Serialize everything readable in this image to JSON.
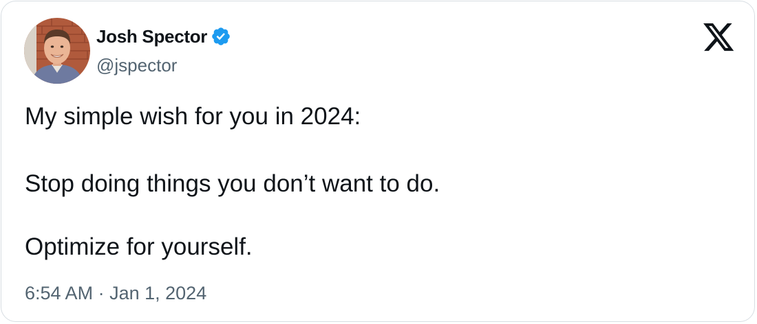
{
  "author": {
    "display_name": "Josh Spector",
    "handle": "@jspector",
    "verified": true,
    "avatar_icon": "profile-photo"
  },
  "platform": {
    "logo_icon": "x-logo-icon"
  },
  "tweet": {
    "lines": [
      "My simple wish for you in 2024:",
      "Stop doing things you don’t want to do.",
      "Optimize for yourself."
    ],
    "time": "6:54 AM",
    "separator": "·",
    "date": "Jan 1, 2024"
  },
  "colors": {
    "text_primary": "#0f1419",
    "text_secondary": "#536471",
    "verified_blue": "#1d9bf0",
    "border": "#d7dde2"
  }
}
